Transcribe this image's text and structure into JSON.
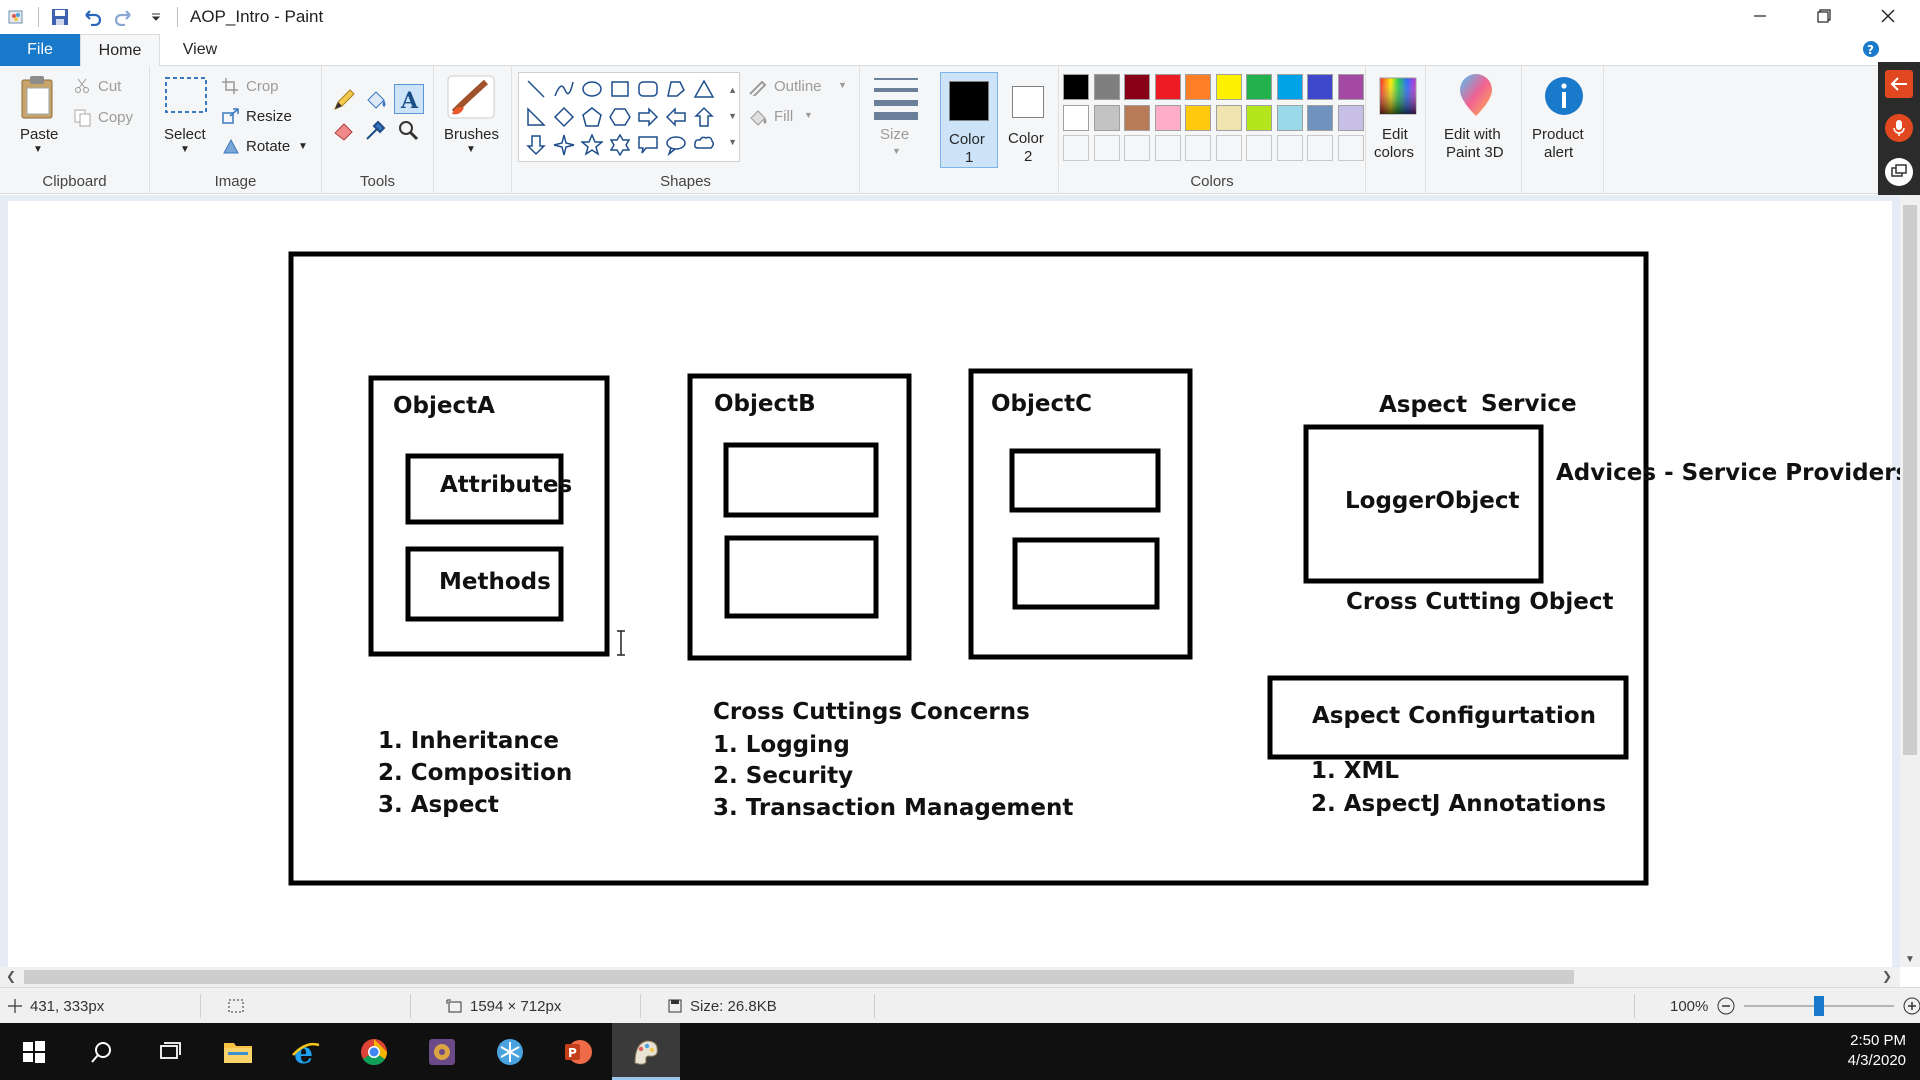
{
  "titlebar": {
    "title": "AOP_Intro - Paint"
  },
  "tabs": {
    "file": "File",
    "home": "Home",
    "view": "View"
  },
  "clipboard": {
    "paste": "Paste",
    "cut": "Cut",
    "copy": "Copy",
    "label": "Clipboard"
  },
  "image": {
    "select": "Select",
    "crop": "Crop",
    "resize": "Resize",
    "rotate": "Rotate",
    "label": "Image"
  },
  "tools": {
    "label": "Tools"
  },
  "brushes": {
    "label": "Brushes"
  },
  "shapes": {
    "outline": "Outline",
    "fill": "Fill",
    "label": "Shapes"
  },
  "size": {
    "label": "Size"
  },
  "color1": {
    "line1": "Color",
    "line2": "1",
    "value": "#000000"
  },
  "color2": {
    "line1": "Color",
    "line2": "2",
    "value": "#ffffff"
  },
  "colors": {
    "label": "Colors",
    "edit_line1": "Edit",
    "edit_line2": "colors",
    "row1": [
      "#000000",
      "#7f7f7f",
      "#880015",
      "#ed1c24",
      "#ff7f27",
      "#fff200",
      "#22b14c",
      "#00a2e8",
      "#3f48cc",
      "#a349a4"
    ],
    "row2": [
      "#ffffff",
      "#c3c3c3",
      "#b97a57",
      "#ffaec9",
      "#ffc90e",
      "#efe4b0",
      "#b5e61d",
      "#99d9ea",
      "#7092be",
      "#c8bfe7"
    ]
  },
  "paint3d": {
    "line1": "Edit with",
    "line2": "Paint 3D"
  },
  "product_alert": {
    "line1": "Product",
    "line2": "alert"
  },
  "drawing": {
    "objectA": "ObjectA",
    "attributes": "Attributes",
    "methods": "Methods",
    "objectB": "ObjectB",
    "objectC": "ObjectC",
    "aspect": "Aspect",
    "service": "Service",
    "logger": "LoggerObject",
    "advices": "Advices - Service Providers",
    "cross_cutting_object": "Cross Cutting Object",
    "aspect_config": "Aspect Configurtation",
    "list1": [
      "1. Inheritance",
      "2. Composition",
      "3. Aspect"
    ],
    "concerns_title": "Cross Cuttings Concerns",
    "list2": [
      "1. Logging",
      "2. Security",
      "3. Transaction Management"
    ],
    "list3": [
      "1. XML",
      "2. AspectJ Annotations"
    ]
  },
  "status": {
    "cursor": "431, 333px",
    "dimensions": "1594 × 712px",
    "size": "Size: 26.8KB",
    "zoom": "100%",
    "zoom_level": 1.0
  },
  "taskbar": {
    "time": "2:50 PM",
    "date": "4/3/2020"
  }
}
